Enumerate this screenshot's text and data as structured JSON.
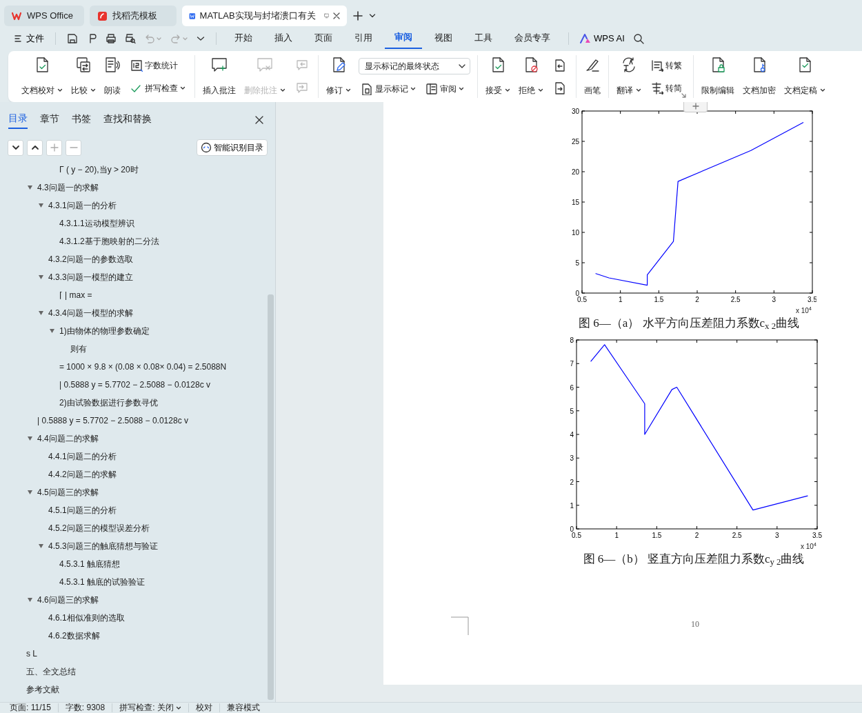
{
  "tabs": [
    {
      "label": "WPS Office",
      "selected": false
    },
    {
      "label": "找稻壳模板",
      "selected": false
    },
    {
      "label": "MATLAB实现与封堵溃口有关",
      "selected": true
    }
  ],
  "menu": {
    "file": "文件",
    "tabs": [
      {
        "label": "开始",
        "selected": false
      },
      {
        "label": "插入",
        "selected": false
      },
      {
        "label": "页面",
        "selected": false
      },
      {
        "label": "引用",
        "selected": false
      },
      {
        "label": "审阅",
        "selected": true
      },
      {
        "label": "视图",
        "selected": false
      },
      {
        "label": "工具",
        "selected": false
      },
      {
        "label": "会员专享",
        "selected": false
      }
    ],
    "ai": "WPS AI"
  },
  "ribbon": {
    "groups": [
      {
        "items": [
          {
            "kind": "large",
            "label": "文档校对",
            "dropdown": true,
            "disabled": false
          },
          {
            "kind": "large",
            "label": "比较",
            "dropdown": true,
            "disabled": false
          },
          {
            "kind": "large",
            "label": "朗读",
            "dropdown": false,
            "disabled": false
          },
          {
            "kind": "stack",
            "items": [
              {
                "kind": "small",
                "label": "字数统计",
                "dropdown": false,
                "disabled": false
              },
              {
                "kind": "small",
                "label": "拼写检查",
                "dropdown": true,
                "disabled": false
              }
            ]
          }
        ]
      },
      {
        "items": [
          {
            "kind": "large",
            "label": "插入批注",
            "dropdown": false,
            "disabled": false
          },
          {
            "kind": "large",
            "label": "删除批注",
            "dropdown": true,
            "disabled": true
          },
          {
            "kind": "stack",
            "items": [
              {
                "kind": "icon",
                "disabled": true
              },
              {
                "kind": "icon",
                "disabled": true
              }
            ]
          }
        ]
      },
      {
        "items": [
          {
            "kind": "large",
            "label": "修订",
            "dropdown": true,
            "disabled": false
          },
          {
            "kind": "stack",
            "items": [
              {
                "kind": "select",
                "value": "显示标记的最终状态"
              },
              {
                "kind": "pair",
                "items": [
                  {
                    "kind": "small",
                    "label": "显示标记",
                    "dropdown": true,
                    "disabled": false
                  },
                  {
                    "kind": "small",
                    "label": "审阅",
                    "dropdown": true,
                    "disabled": false
                  }
                ]
              }
            ]
          }
        ]
      },
      {
        "items": [
          {
            "kind": "large",
            "label": "接受",
            "dropdown": true,
            "disabled": false
          },
          {
            "kind": "large",
            "label": "拒绝",
            "dropdown": true,
            "disabled": false
          },
          {
            "kind": "stack",
            "items": [
              {
                "kind": "icon",
                "disabled": false
              },
              {
                "kind": "icon",
                "disabled": false
              }
            ]
          }
        ]
      },
      {
        "items": [
          {
            "kind": "large",
            "label": "画笔",
            "dropdown": false,
            "disabled": false
          }
        ]
      },
      {
        "items": [
          {
            "kind": "large",
            "label": "翻译",
            "dropdown": true,
            "disabled": false
          },
          {
            "kind": "stack",
            "items": [
              {
                "kind": "small",
                "label": "转繁",
                "dropdown": false,
                "disabled": false
              },
              {
                "kind": "small",
                "label": "转简",
                "dropdown": false,
                "disabled": false
              }
            ]
          }
        ]
      },
      {
        "items": [
          {
            "kind": "large",
            "label": "限制编辑",
            "dropdown": false,
            "disabled": false
          },
          {
            "kind": "large",
            "label": "文档加密",
            "dropdown": false,
            "disabled": false
          },
          {
            "kind": "large",
            "label": "文档定稿",
            "dropdown": true,
            "disabled": false
          }
        ]
      }
    ]
  },
  "panel": {
    "tabs": [
      {
        "label": "目录",
        "selected": true
      },
      {
        "label": "章节",
        "selected": false
      },
      {
        "label": "书签",
        "selected": false
      },
      {
        "label": "查找和替换",
        "selected": false
      }
    ],
    "smart_button": "智能识别目录",
    "toc": [
      {
        "kind": "fragment",
        "text": "Γ ( y − 20),当y > 20时"
      },
      {
        "kind": "section",
        "text": "4.3问题一的求解",
        "expanded": true,
        "children": [
          {
            "text": "4.3.1问题一的分析",
            "expanded": true,
            "children": [
              {
                "text": "4.3.1.1运动模型辨识"
              },
              {
                "text": "4.3.1.2基于胞映射的二分法"
              }
            ]
          },
          {
            "text": "4.3.2问题一的参数选取"
          },
          {
            "text": "4.3.3问题一模型的建立",
            "expanded": true,
            "children": [
              {
                "text": "⌈ |    max ="
              }
            ]
          },
          {
            "text": "4.3.4问题一模型的求解",
            "expanded": true,
            "children": [
              {
                "text": "1)由物体的物理参数确定",
                "expanded": true,
                "children": [
                  {
                    "text": "则有"
                  }
                ]
              },
              {
                "text": "= 1000 × 9.8 × (0.08 × 0.08× 0.04) = 2.5088N"
              },
              {
                "text": "|   0.5888  y = 5.7702 − 2.5088 − 0.0128c v"
              },
              {
                "text": "2)由试验数据进行参数寻优"
              }
            ]
          }
        ]
      },
      {
        "kind": "section",
        "text": "|   0.5888   y = 5.7702 − 2.5088 − 0.0128c v"
      },
      {
        "kind": "section",
        "text": "4.4问题二的求解",
        "expanded": true,
        "children": [
          {
            "text": "4.4.1问题二的分析"
          },
          {
            "text": "4.4.2问题二的求解"
          }
        ]
      },
      {
        "kind": "section",
        "text": "4.5问题三的求解",
        "expanded": true,
        "children": [
          {
            "text": "4.5.1问题三的分析"
          },
          {
            "text": "4.5.2问题三的模型误差分析"
          },
          {
            "text": "4.5.3问题三的触底猜想与验证",
            "expanded": true,
            "children": [
              {
                "text": "4.5.3.1 触底猜想"
              },
              {
                "text": "4.5.3.1 触底的试验验证"
              }
            ]
          }
        ]
      },
      {
        "kind": "section",
        "text": "4.6问题三的求解",
        "expanded": true,
        "children": [
          {
            "text": "4.6.1相似准则的选取"
          },
          {
            "text": "4.6.2数据求解"
          }
        ]
      },
      {
        "kind": "chapter",
        "text": "s  L"
      },
      {
        "kind": "chapter",
        "text": "五、全文总结"
      },
      {
        "kind": "chapter",
        "text": "参考文献"
      }
    ]
  },
  "document": {
    "figures": [
      {
        "chart_data": {
          "type": "line",
          "x": [
            0.68,
            0.85,
            1.35,
            1.35,
            1.69,
            1.75,
            2.7,
            3.38
          ],
          "series": [
            {
              "color": "#0000ff",
              "values": [
                3.2,
                2.5,
                1.3,
                3.0,
                8.5,
                18.4,
                23.5,
                28.1
              ]
            }
          ],
          "xlim": [
            0.5,
            3.5
          ],
          "ylim": [
            0,
            30
          ],
          "xticks": [
            0.5,
            1,
            1.5,
            2,
            2.5,
            3,
            3.5
          ],
          "yticks": [
            0,
            5,
            10,
            15,
            20,
            25,
            30
          ]
        },
        "axis_multiplier": "x 10$^{4}$",
        "caption": "图  6—（a）  水平方向压差阻力系数c$_{x 2}$曲线"
      },
      {
        "chart_data": {
          "type": "line",
          "x": [
            0.68,
            0.85,
            1.35,
            1.35,
            1.69,
            1.75,
            2.7,
            3.38
          ],
          "series": [
            {
              "color": "#0000ff",
              "values": [
                7.1,
                7.8,
                5.3,
                4.0,
                5.9,
                6.0,
                0.8,
                1.4
              ]
            }
          ],
          "xlim": [
            0.5,
            3.5
          ],
          "ylim": [
            0,
            8
          ],
          "xticks": [
            0.5,
            1,
            1.5,
            2,
            2.5,
            3,
            3.5
          ],
          "yticks": [
            0,
            1,
            2,
            3,
            4,
            5,
            6,
            7,
            8
          ]
        },
        "axis_multiplier": "x 10$^{4}$",
        "caption": "图  6—（b）  竖直方向压差阻力系数c$_{y 2}$曲线"
      }
    ],
    "page_number": "10"
  },
  "status_bar": [
    {
      "label": "页面: 11/15",
      "dropdown": false
    },
    {
      "label": "字数: 9308",
      "dropdown": false
    },
    {
      "label": "拼写检查: 关闭",
      "dropdown": true
    },
    {
      "label": "校对",
      "dropdown": false
    },
    {
      "label": "兼容模式",
      "dropdown": false
    }
  ]
}
